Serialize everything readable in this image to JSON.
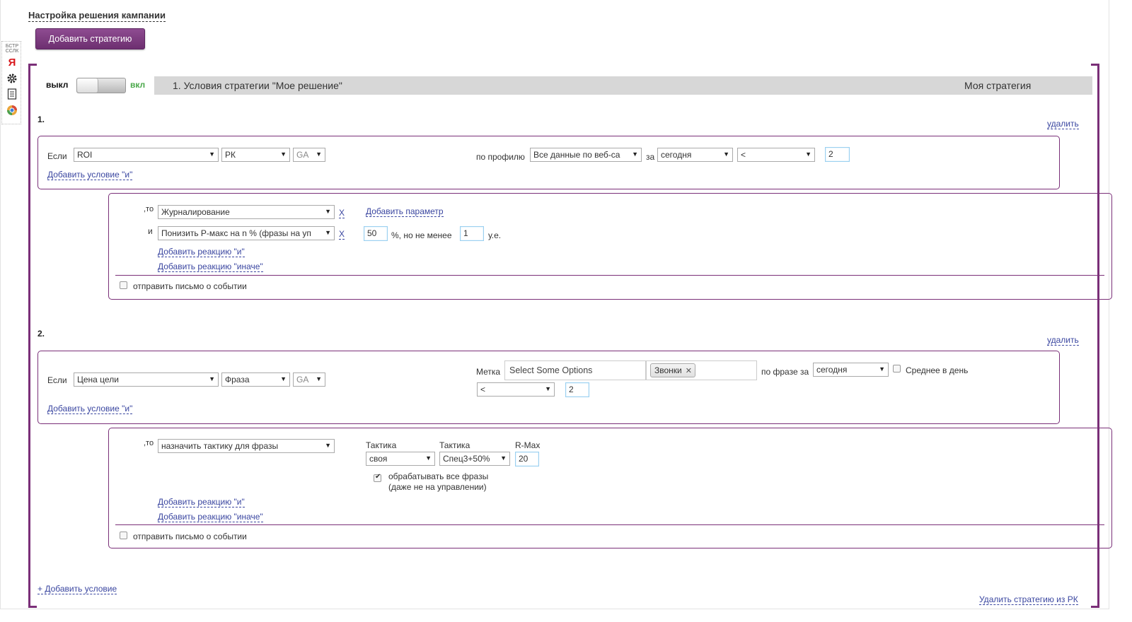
{
  "page": {
    "title": "Настройка решения кампании",
    "add_strategy_label": "Добавить стратегию"
  },
  "toolbar": {
    "bstr_label": "БСТР ССЛК",
    "yandex_label": "Я"
  },
  "strategy": {
    "toggle_off_label": "выкл",
    "toggle_on_label": "вкл",
    "enabled": false,
    "header_title": "1. Условия стратегии \"Мое решение\"",
    "header_right": "Моя стратегия",
    "add_condition_label": "+ Добавить условие",
    "remove_strategy_label": "Удалить стратегию из РК"
  },
  "conditions": [
    {
      "number": "1.",
      "delete_label": "удалить",
      "if_label": "Если",
      "metric": "ROI",
      "level": "РК",
      "source": "GA",
      "profile_label": "по профилю",
      "profile": "Все данные по веб-са",
      "period_label": "за",
      "period": "сегодня",
      "operator": "<",
      "value": "2",
      "add_and_condition_label": "Добавить условие \"и\"",
      "then_label": ",то",
      "and_label": "и",
      "reaction_1": "Журналирование",
      "reaction_2": "Понизить Р-макс на n % (фразы на уп",
      "remove_x": "X",
      "add_param_label": "Добавить параметр",
      "percent_value": "50",
      "percent_suffix": "%, но не менее",
      "min_value": "1",
      "unit": "у.е.",
      "add_reaction_and_label": "Добавить реакцию \"и\"",
      "add_reaction_else_label": "Добавить реакцию \"иначе\"",
      "send_email_label": "отправить письмо о событии",
      "send_email_checked": false
    },
    {
      "number": "2.",
      "delete_label": "удалить",
      "if_label": "Если",
      "metric": "Цена цели",
      "level": "Фраза",
      "source": "GA",
      "tag_label": "Метка",
      "tag_placeholder": "Select Some Options",
      "selected_tag": "Звонки",
      "tag_remove": "✕",
      "by_phrase_label": "по фразе за",
      "period": "сегодня",
      "avg_per_day_label": "Среднее в день",
      "avg_per_day_checked": false,
      "operator": "<",
      "value": "2",
      "add_and_condition_label": "Добавить условие \"и\"",
      "then_label": ",то",
      "reaction_1": "назначить тактику для фразы",
      "tactic_label_1": "Тактика",
      "tactic_1": "своя",
      "tactic_label_2": "Тактика",
      "tactic_2": "Спец3+50%",
      "rmax_label": "R-Max",
      "rmax_value": "20",
      "process_all_line1": "обрабатывать все фразы",
      "process_all_line2": "(даже не на управлении)",
      "process_all_checked": true,
      "add_reaction_and_label": "Добавить реакцию \"и\"",
      "add_reaction_else_label": "Добавить реакцию \"иначе\"",
      "send_email_label": "отправить письмо о событии",
      "send_email_checked": false
    }
  ],
  "colors": {
    "accent": "#7a2f78",
    "button": "#7b3d7e",
    "link": "#3a46a0",
    "on_label": "#4aa84a",
    "header_bar": "#d7d7d7"
  },
  "icons": [
    "bstr-icon",
    "yandex-icon",
    "gear-icon",
    "document-icon",
    "chrome-icon"
  ]
}
